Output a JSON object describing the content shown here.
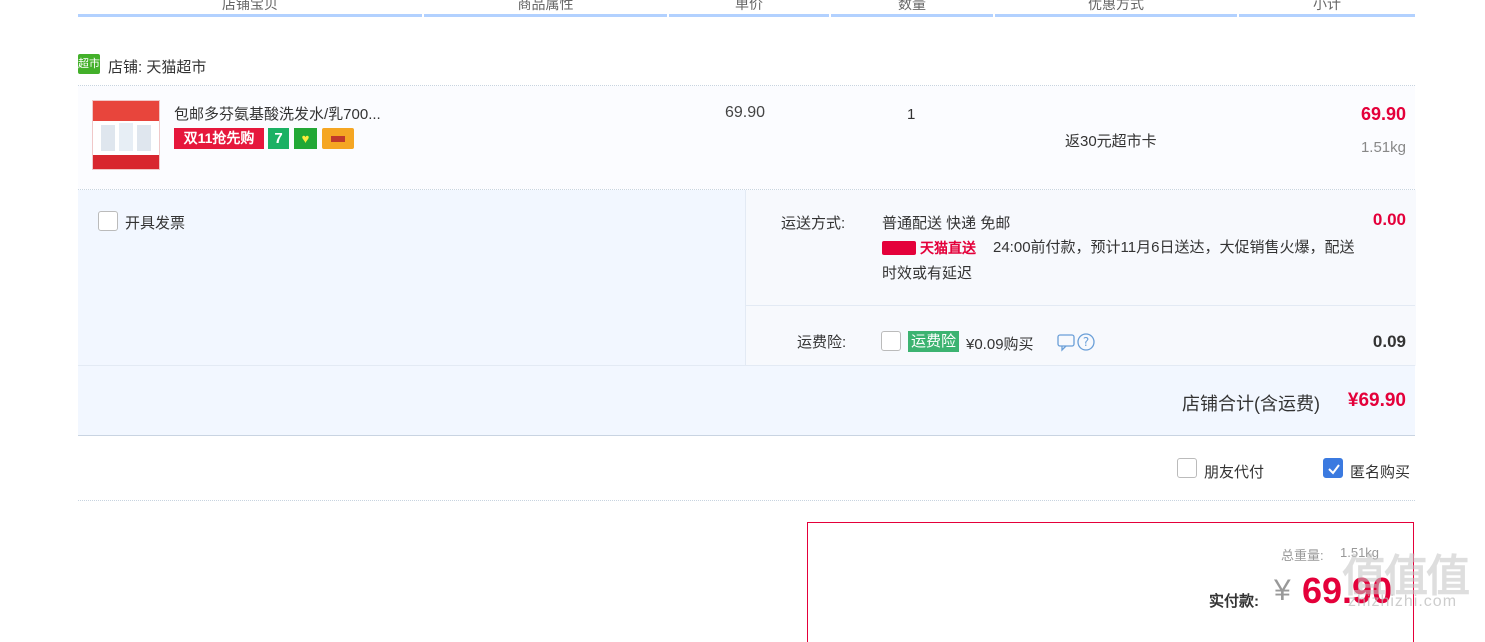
{
  "table_header": {
    "columns": [
      "店铺宝贝",
      "商品属性",
      "单价",
      "数量",
      "优惠方式",
      "小计"
    ]
  },
  "shop": {
    "icon_text": "超市",
    "label": "店铺: 天猫超市"
  },
  "item": {
    "title": "包邮多芬氨基酸洗发水/乳700...",
    "badge_sale": "双11抢先购",
    "badge_7": "7",
    "badge_g": "♥",
    "unit_price": "69.90",
    "quantity": "1",
    "promotion": "返30元超市卡",
    "subtotal": "69.90",
    "weight": "1.51kg"
  },
  "invoice": {
    "label": "开具发票",
    "checked": false
  },
  "shipping": {
    "label": "运送方式:",
    "method": "普通配送 快递 免邮",
    "tmall_direct": "天猫直送",
    "note_line1": "24:00前付款，预计11月6日送达，大促销售火爆，配送",
    "note_line2": "时效或有延迟",
    "fee": "0.00"
  },
  "insurance": {
    "label": "运费险:",
    "badge": "运费险",
    "price_text": "¥0.09购买",
    "fee": "0.09"
  },
  "shop_total": {
    "label": "店铺合计(含运费)",
    "amount": "¥69.90"
  },
  "options": {
    "friend_pay": "朋友代付",
    "anonymous": "匿名购买"
  },
  "payment": {
    "weight_label": "总重量:",
    "weight_value": "1.51kg",
    "pay_label": "实付款:",
    "currency": "¥",
    "amount": "69.90"
  },
  "watermark": {
    "text": "值值值",
    "site": "zhizhizhi.com"
  },
  "colors": {
    "accent_red": "#e4003a",
    "header_bar": "#b2d1ff",
    "check_blue": "#3b7ae0"
  }
}
